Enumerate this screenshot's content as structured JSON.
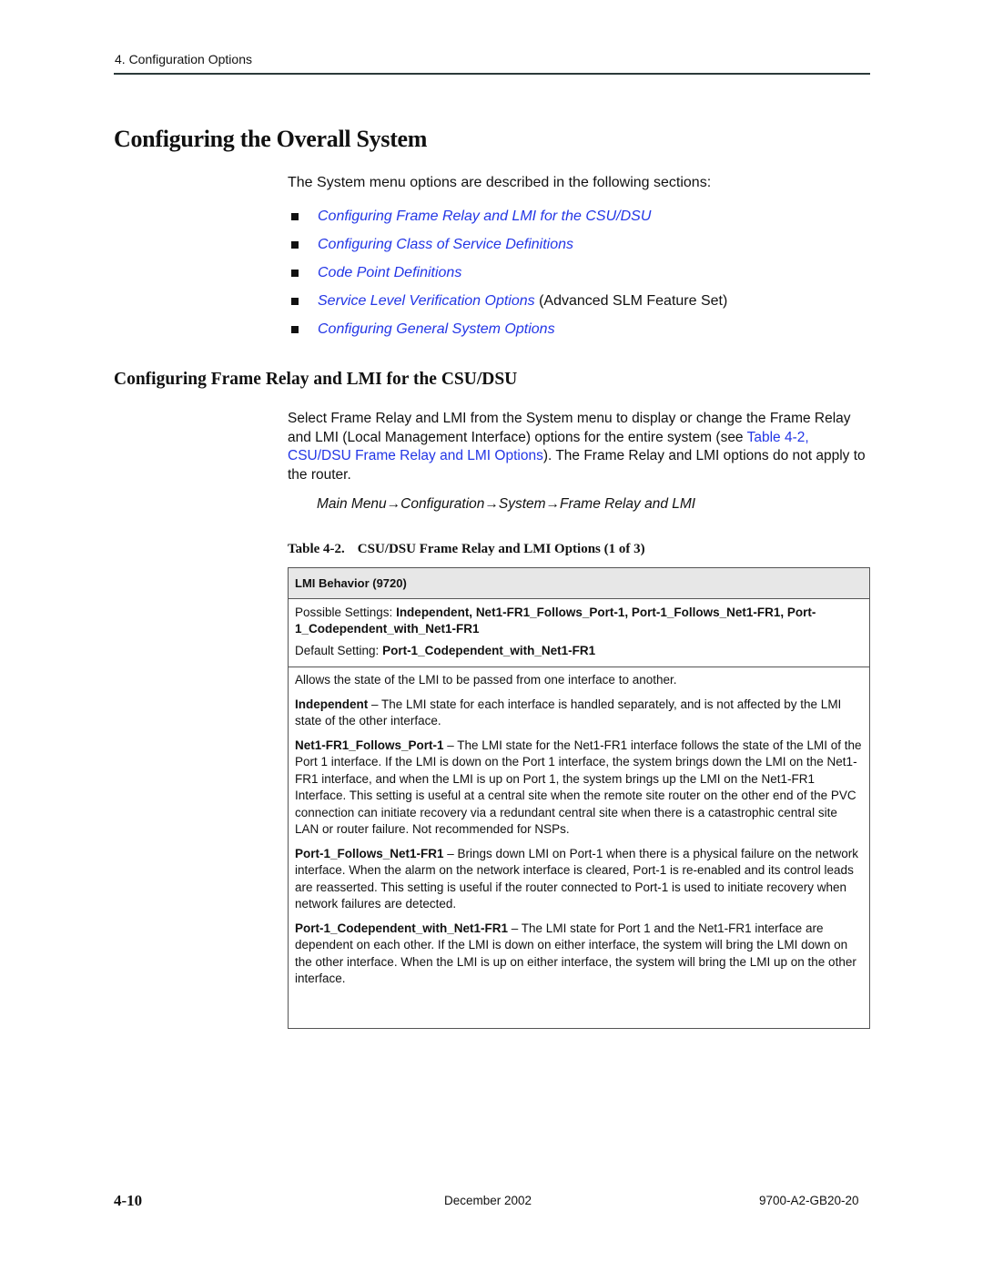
{
  "header": {
    "chapter": "4. Configuration Options"
  },
  "section": {
    "title": "Configuring the Overall System",
    "intro": "The System menu options are described in the following sections:",
    "links": [
      {
        "label": "Configuring Frame Relay and LMI for the CSU/DSU",
        "suffix": ""
      },
      {
        "label": "Configuring Class of Service Definitions",
        "suffix": ""
      },
      {
        "label": "Code Point Definitions",
        "suffix": ""
      },
      {
        "label": "Service Level Verification Options",
        "suffix": " (Advanced SLM Feature Set)"
      },
      {
        "label": "Configuring General System Options",
        "suffix": ""
      }
    ]
  },
  "subsection": {
    "title": "Configuring Frame Relay and LMI for the CSU/DSU",
    "para_before": "Select Frame Relay and LMI from the System menu to display or change the Frame Relay and LMI (Local Management Interface) options for the entire system (see ",
    "para_xref": "Table 4-2, CSU/DSU Frame Relay and LMI Options",
    "para_after": "). The Frame Relay and LMI options do not apply to the router.",
    "menu_path": "Main Menu→Configuration→System→Frame Relay and LMI"
  },
  "table": {
    "caption_number": "Table 4-2.",
    "caption_title": "CSU/DSU Frame Relay and LMI Options (1 of 3)",
    "option_name": "LMI Behavior (9720)",
    "possible_label": "Possible Settings: ",
    "possible_values": "Independent, Net1-FR1_Follows_Port-1, Port-1_Follows_Net1-FR1, Port-1_Codependent_with_Net1-FR1",
    "default_label": "Default Setting: ",
    "default_value": "Port-1_Codependent_with_Net1-FR1",
    "summary": "Allows the state of the LMI to be passed from one interface to another.",
    "descriptions": [
      {
        "term": "Independent",
        "text": " – The LMI state for each interface is handled separately, and is not affected by the LMI state of the other interface."
      },
      {
        "term": "Net1-FR1_Follows_Port-1",
        "text": " – The LMI state for the Net1-FR1 interface follows the state of the LMI of the Port 1 interface. If the LMI is down on the Port 1 interface, the system brings down the LMI on the Net1-FR1 interface, and when the LMI is up on Port 1, the system brings up the LMI on the Net1-FR1 Interface. This setting is useful at a central site when the remote site router on the other end of the PVC connection can initiate recovery via a redundant central site when there is a catastrophic central site LAN or router failure. Not recommended for NSPs."
      },
      {
        "term": "Port-1_Follows_Net1-FR1",
        "text": " – Brings down LMI on Port-1 when there is a physical failure on the network interface. When the alarm on the network interface is cleared, Port-1 is re-enabled and its control leads are reasserted. This setting is useful if the router connected to Port-1 is used to initiate recovery when network failures are detected."
      },
      {
        "term": "Port-1_Codependent_with_Net1-FR1",
        "text": " – The LMI state for Port 1 and the Net1-FR1 interface are dependent on each other. If the LMI is down on either interface, the system will bring the LMI down on the other interface. When the LMI is up on either interface, the system will bring the LMI up on the other interface."
      }
    ]
  },
  "footer": {
    "page": "4-10",
    "date": "December 2002",
    "doc_number": "9700-A2-GB20-20"
  },
  "colors": {
    "link": "#2336e6",
    "table_header_bg": "#e7e7e7"
  }
}
